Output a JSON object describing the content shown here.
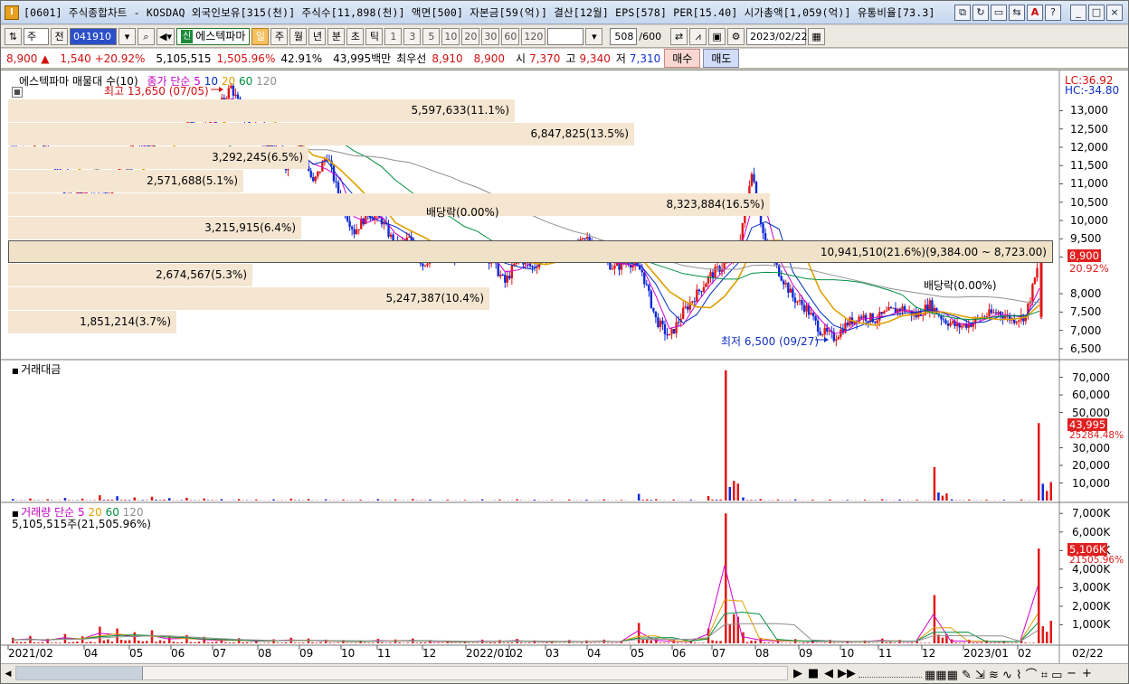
{
  "window": {
    "title": "[0601] 주식종합차트 - KOSDAQ 외국인보유[315(천)] 주식수[11,898(천)] 액면[500] 자본금[59(억)] 결산[12월] EPS[578] PER[15.40] 시가총액[1,059(억)] 유통비율[73.3]",
    "app_icon": "I",
    "buttons": [
      "⧉",
      "↻",
      "▭",
      "⇆",
      "A",
      "?",
      "_",
      "□",
      "×"
    ]
  },
  "toolbar": {
    "market": "주",
    "prev": "전",
    "code": "041910",
    "stock_name": "에스텍파마",
    "sin_badge": "신",
    "periods": [
      "일",
      "주",
      "월",
      "년",
      "분",
      "초",
      "틱"
    ],
    "active_period": "일",
    "counts": [
      "1",
      "3",
      "5",
      "10",
      "20",
      "30",
      "60",
      "120"
    ],
    "bars_shown": "508",
    "bars_total": "/600",
    "date": "2023/02/22"
  },
  "quote": {
    "price": "8,900",
    "arrow": "▲",
    "change": "1,540",
    "change_pct": "+20.92%",
    "volume": "5,105,515",
    "volume_pct": "1,505.96%",
    "turnover_pct": "42.91%",
    "amount": "43,995백만",
    "best_label": "최우선",
    "ask": "8,910",
    "bid": "8,900",
    "open_label": "시",
    "open": "7,370",
    "high_label": "고",
    "high": "9,340",
    "low_label": "저",
    "low": "7,310",
    "buy": "매수",
    "sell": "매도"
  },
  "price_panel": {
    "header_stock": "에스텍파마 매물대 수(10)",
    "ma_label": "종가 단순",
    "ma_periods": [
      "5",
      "10",
      "20",
      "60",
      "120"
    ],
    "ma_colors": [
      "#d000d0",
      "#0030c0",
      "#e0a000",
      "#009040",
      "#909090"
    ],
    "high_note": "최고 13,650 (07/05)",
    "low_note": "최저 6,500 (09/27)",
    "dividend_note": "배당락(0.00%)",
    "lc": "LC:36.92",
    "hc": "HC:-34.80",
    "price_tag": "8,900",
    "price_tag_pct": "20.92%",
    "volume_profile": [
      {
        "label": "5,597,633(11.1%)"
      },
      {
        "label": "6,847,825(13.5%)"
      },
      {
        "label": "3,292,245(6.5%)"
      },
      {
        "label": "2,571,688(5.1%)"
      },
      {
        "label": "8,323,884(16.5%)"
      },
      {
        "label": "3,215,915(6.4%)"
      },
      {
        "label": "10,941,510(21.6%)(9,384.00 ~ 8,723.00)"
      },
      {
        "label": "2,674,567(5.3%)"
      },
      {
        "label": "5,247,387(10.4%)"
      },
      {
        "label": "1,851,214(3.7%)"
      }
    ],
    "y_ticks": [
      "13,000",
      "12,500",
      "12,000",
      "11,500",
      "11,000",
      "10,500",
      "10,000",
      "9,500",
      "9,000",
      "8,000",
      "7,500",
      "7,000",
      "6,500"
    ]
  },
  "amount_panel": {
    "title": "거래대금",
    "y_ticks": [
      "70,000",
      "60,000",
      "50,000",
      "30,000",
      "20,000",
      "10,000"
    ],
    "tag": "43,995",
    "tag_sub": "25284.48%"
  },
  "volume_panel": {
    "title": "거래량",
    "ma_label": "단순",
    "ma_periods": [
      "5",
      "20",
      "60",
      "120"
    ],
    "value_note": "5,105,515주(21,505.96%)",
    "y_ticks": [
      "7,000K",
      "6,000K",
      "5,000K",
      "4,000K",
      "3,000K",
      "2,000K",
      "1,000K"
    ],
    "tag": "5,106K",
    "tag_sub": "21505.96%"
  },
  "x_axis": [
    "2021/02",
    "04",
    "05",
    "06",
    "07",
    "08",
    "09",
    "10",
    "11",
    "12",
    "2022/01",
    "02",
    "03",
    "04",
    "05",
    "06",
    "07",
    "08",
    "09",
    "10",
    "11",
    "12",
    "2023/01",
    "02"
  ],
  "x_axis_right": "02/22",
  "scroll_tools": [
    "▶",
    "■",
    "◀",
    "▶▶",
    "−",
    "+"
  ],
  "chart_data": {
    "type": "candlestick",
    "x_start": "2021/02",
    "x_end": "2023/02/22",
    "ylim": [
      6300,
      13800
    ],
    "price_close_series": [
      12000,
      11800,
      12200,
      11600,
      10500,
      10800,
      11000,
      10700,
      11500,
      12300,
      11900,
      12500,
      12200,
      12700,
      12400,
      13000,
      13650,
      12800,
      12300,
      12000,
      11500,
      12100,
      11000,
      11800,
      10500,
      9700,
      10200,
      10000,
      9300,
      9500,
      8800,
      9200,
      9100,
      9000,
      9300,
      8900,
      8300,
      9000,
      8700,
      9100,
      9300,
      9200,
      9500,
      9000,
      8700,
      8900,
      8600,
      7300,
      6800,
      7500,
      8000,
      8500,
      8800,
      9200,
      11400,
      9300,
      8600,
      7900,
      7600,
      7000,
      6800,
      7200,
      7400,
      7300,
      7500,
      7600,
      7400,
      7700,
      7300,
      7100,
      7200,
      7400,
      7500,
      7300,
      7400,
      8900
    ],
    "amount_series_millions": [
      900,
      1200,
      800,
      1500,
      1100,
      3000,
      2500,
      1800,
      2200,
      1400,
      1600,
      1200,
      800,
      900,
      600,
      700,
      1100,
      900,
      700,
      600,
      500,
      800,
      700,
      900,
      600,
      500,
      400,
      700,
      600,
      800,
      500,
      400,
      600,
      500,
      700,
      400,
      3800,
      800,
      600,
      500,
      2600,
      74000,
      1800,
      900,
      600,
      700,
      500,
      600,
      400,
      500,
      800,
      600,
      500,
      19000,
      700,
      600,
      500,
      400,
      600,
      43995
    ],
    "volume_series_k": [
      300,
      400,
      250,
      500,
      380,
      900,
      800,
      600,
      700,
      400,
      450,
      350,
      250,
      280,
      200,
      220,
      300,
      260,
      200,
      180,
      160,
      240,
      210,
      260,
      180,
      150,
      130,
      200,
      180,
      240,
      160,
      130,
      180,
      160,
      200,
      130,
      1100,
      260,
      190,
      160,
      800,
      7000,
      600,
      300,
      200,
      230,
      170,
      190,
      140,
      160,
      260,
      190,
      160,
      2600,
      220,
      190,
      160,
      130,
      190,
      5106
    ]
  }
}
